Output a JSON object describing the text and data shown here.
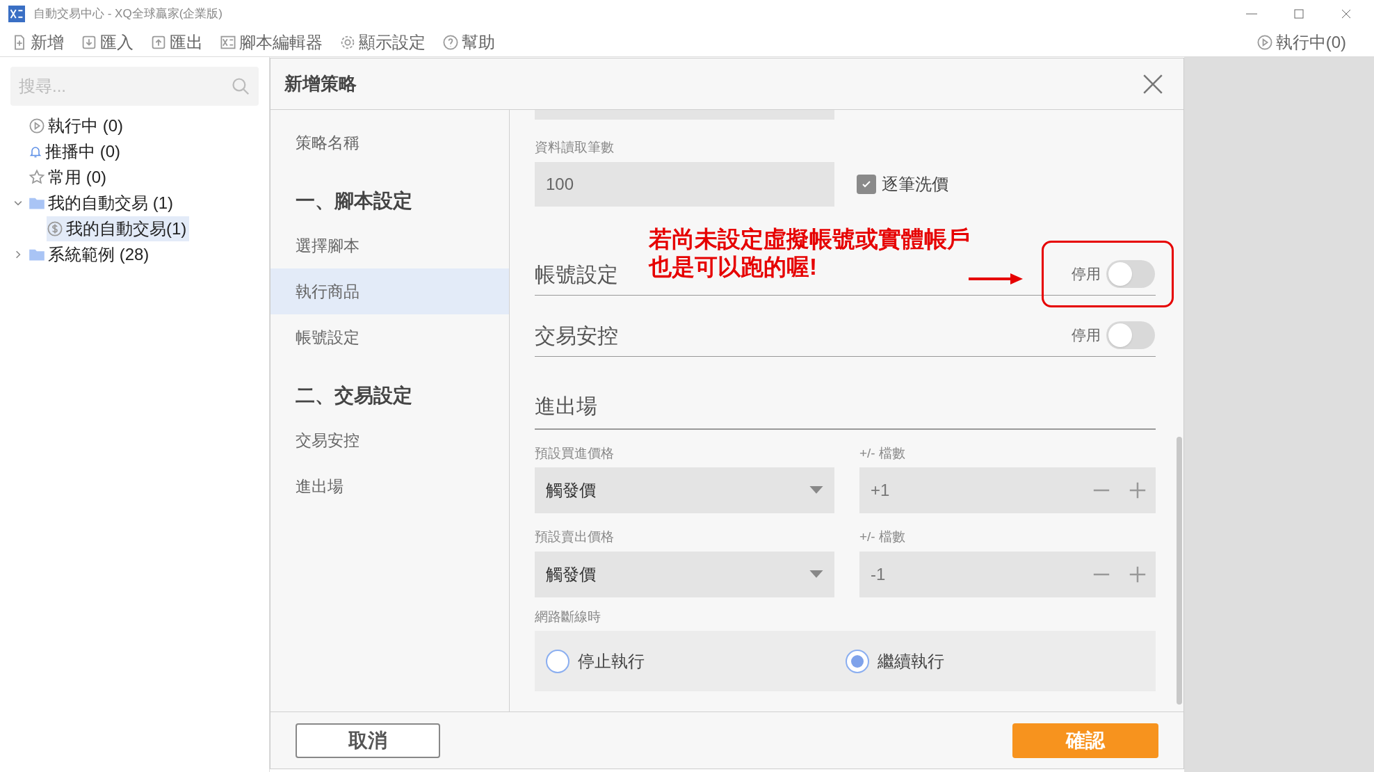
{
  "window": {
    "title": "自動交易中心 - XQ全球贏家(企業版)"
  },
  "toolbar": {
    "items": [
      "新增",
      "匯入",
      "匯出",
      "腳本編輯器",
      "顯示設定",
      "幫助"
    ],
    "status": "執行中(0)"
  },
  "sidebar": {
    "search": {
      "placeholder": "搜尋..."
    },
    "tree": [
      {
        "label": "執行中 (0)"
      },
      {
        "label": "推播中 (0)"
      },
      {
        "label": "常用 (0)"
      },
      {
        "label": "我的自動交易 (1)",
        "expanded": true,
        "children": [
          {
            "label": "我的自動交易(1)",
            "selected": true
          }
        ]
      },
      {
        "label": "系統範例 (28)",
        "expanded": false
      }
    ]
  },
  "dialog": {
    "title": "新增策略",
    "nav": [
      {
        "kind": "item",
        "label": "策略名稱",
        "selected": false
      },
      {
        "kind": "heading",
        "label": "一、腳本設定"
      },
      {
        "kind": "item",
        "label": "選擇腳本",
        "selected": false
      },
      {
        "kind": "item",
        "label": "執行商品",
        "selected": true
      },
      {
        "kind": "item",
        "label": "帳號設定",
        "selected": false
      },
      {
        "kind": "heading",
        "label": "二、交易設定"
      },
      {
        "kind": "item",
        "label": "交易安控",
        "selected": false
      },
      {
        "kind": "item",
        "label": "進出場",
        "selected": false
      }
    ],
    "data_count": {
      "label": "資料讀取筆數",
      "value": "100",
      "checkbox": {
        "label": "逐筆洗價",
        "checked": true
      }
    },
    "sections": [
      {
        "title": "帳號設定",
        "toggle_label": "停用",
        "on": false,
        "highlighted": true
      },
      {
        "title": "交易安控",
        "toggle_label": "停用",
        "on": false,
        "highlighted": false
      }
    ],
    "annotation": {
      "lines": [
        "若尚未設定虛擬帳號或實體帳戶",
        "也是可以跑的喔!"
      ]
    },
    "entry_exit": {
      "title": "進出場",
      "rows": [
        {
          "price_label": "預設買進價格",
          "price_value": "觸發價",
          "ticks_label": "+/- 檔數",
          "ticks_value": "+1"
        },
        {
          "price_label": "預設賣出價格",
          "price_value": "觸發價",
          "ticks_label": "+/- 檔數",
          "ticks_value": "-1"
        }
      ],
      "disconnect": {
        "label": "網路斷線時",
        "options": [
          {
            "label": "停止執行",
            "selected": false
          },
          {
            "label": "繼續執行",
            "selected": true
          }
        ]
      }
    },
    "buttons": {
      "cancel": "取消",
      "confirm": "確認"
    }
  }
}
